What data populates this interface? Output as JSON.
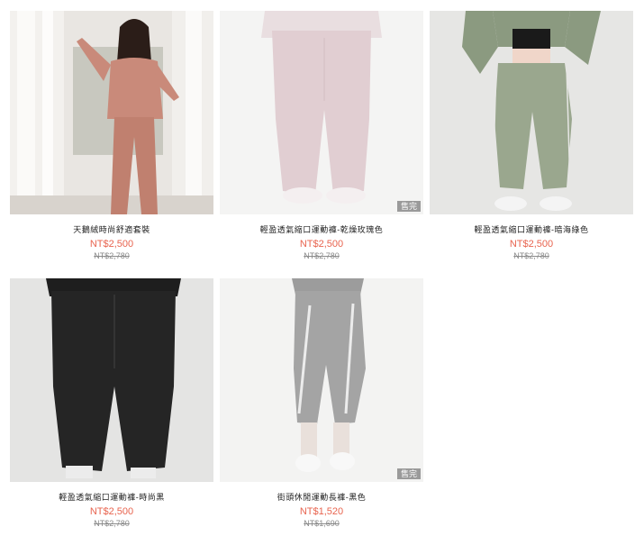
{
  "products": [
    {
      "name": "天鵝絨時尚舒適套裝",
      "price": "NT$2,500",
      "original_price": "NT$2,780",
      "sold_out": false,
      "badge": ""
    },
    {
      "name": "輕盈透氣縮口運動褲-乾燥玫瑰色",
      "price": "NT$2,500",
      "original_price": "NT$2,780",
      "sold_out": true,
      "badge": "售完"
    },
    {
      "name": "輕盈透氣縮口運動褲-暗海綠色",
      "price": "NT$2,500",
      "original_price": "NT$2,780",
      "sold_out": false,
      "badge": ""
    },
    {
      "name": "輕盈透氣縮口運動褲-時尚黑",
      "price": "NT$2,500",
      "original_price": "NT$2,780",
      "sold_out": false,
      "badge": ""
    },
    {
      "name": "街頭休閒運動長褲-黑色",
      "price": "NT$1,520",
      "original_price": "NT$1,690",
      "sold_out": true,
      "badge": "售完"
    }
  ],
  "colors": {
    "price": "#e8644f",
    "strike": "#8a8a8a",
    "badge_bg": "#9a9a9a"
  }
}
